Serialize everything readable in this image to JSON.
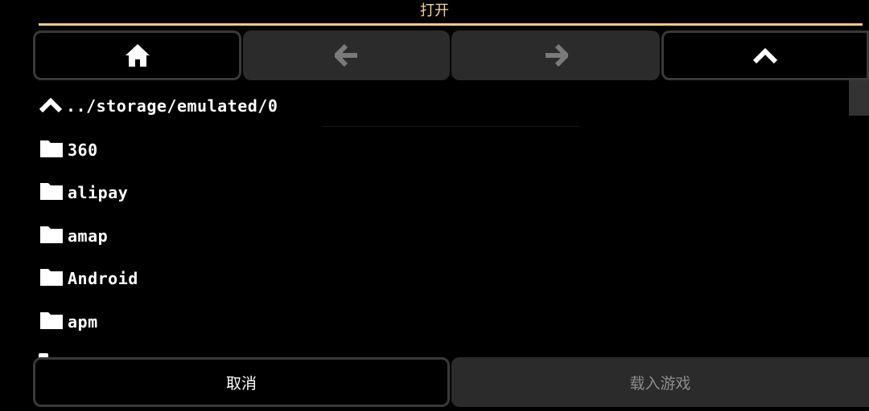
{
  "dialog": {
    "title": "打开"
  },
  "toolbar": {
    "home_icon": "home-icon",
    "back_icon": "arrow-left-icon",
    "forward_icon": "arrow-right-icon",
    "up_icon": "chevron-up-icon"
  },
  "path": {
    "text": "../storage/emulated/0"
  },
  "items": [
    {
      "label": "360",
      "icon": "folder-icon"
    },
    {
      "label": "alipay",
      "icon": "folder-icon"
    },
    {
      "label": "amap",
      "icon": "folder-icon"
    },
    {
      "label": "Android",
      "icon": "folder-icon"
    },
    {
      "label": "apm",
      "icon": "folder-icon"
    }
  ],
  "actions": {
    "cancel_label": "取消",
    "load_label": "载入游戏"
  },
  "colors": {
    "title": "#f3d6a0",
    "accent_line": "#f2c98a",
    "button_fill": "#2b2b2b",
    "button_border": "#3a3a3a",
    "disabled_text": "#8c8c8c"
  }
}
